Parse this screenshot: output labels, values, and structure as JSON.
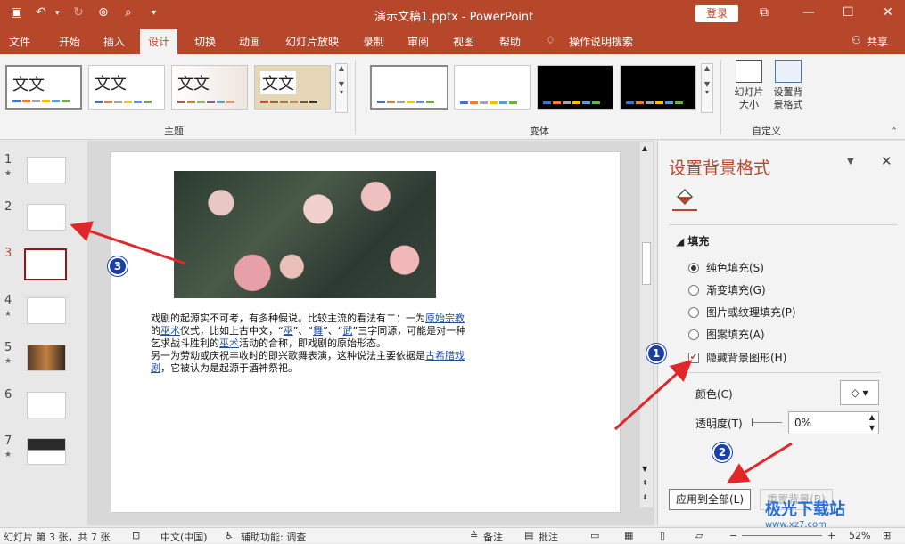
{
  "window": {
    "title": "演示文稿1.pptx  -  PowerPoint",
    "login_label": "登录",
    "share_label": "共享",
    "tell_me": "操作说明搜索"
  },
  "tabs": [
    "文件",
    "开始",
    "插入",
    "设计",
    "切换",
    "动画",
    "幻灯片放映",
    "录制",
    "审阅",
    "视图",
    "帮助"
  ],
  "ribbon": {
    "theme_group_label": "主题",
    "variant_group_label": "变体",
    "custom_group_label": "自定义",
    "theme_samples": [
      "文文",
      "文文",
      "文文",
      "文文"
    ],
    "slide_size_label": "幻灯片\n大小",
    "format_bg_label": "设置背\n景格式"
  },
  "thumbnails": [
    {
      "num": "1",
      "star": "★"
    },
    {
      "num": "2",
      "star": ""
    },
    {
      "num": "3",
      "star": ""
    },
    {
      "num": "4",
      "star": "★"
    },
    {
      "num": "5",
      "star": "★"
    },
    {
      "num": "6",
      "star": ""
    },
    {
      "num": "7",
      "star": "★"
    }
  ],
  "slide": {
    "line1a": "戏剧的起源实不可考，有多种假说。比较主流的看法有二：一为",
    "link1": "原始宗教",
    "line1b": "的",
    "link2": "巫术",
    "line1c": "仪式，比如上古中文，“",
    "link3": "巫",
    "line1d": "”、“",
    "link4": "舞",
    "line1e": "”、“",
    "link5": "武",
    "line1f": "”三字同源，可能是对一种乞求战斗胜利的",
    "link6": "巫术",
    "line1g": "活动的合称，即戏剧的原始形态。",
    "line2a": "另一为劳动或庆祝丰收时的即兴歌舞表演，这种说法主要依据是",
    "link7": "古希腊戏剧",
    "line2b": "，它被认为是起源于酒神祭祀。"
  },
  "pane": {
    "title": "设置背景格式",
    "fill_header": "填充",
    "options": [
      "纯色填充(S)",
      "渐变填充(G)",
      "图片或纹理填充(P)",
      "图案填充(A)"
    ],
    "hide_bg_label": "隐藏背景图形(H)",
    "color_label": "颜色(C)",
    "transparency_label": "透明度(T)",
    "transparency_value": "0%",
    "apply_all_label": "应用到全部(L)",
    "reset_label": "重置背景(B)"
  },
  "status": {
    "slide_info": "幻灯片 第 3 张，共 7 张",
    "language": "中文(中国)",
    "accessibility": "辅助功能: 调查",
    "notes": "备注",
    "comments": "批注",
    "zoom": "52%"
  },
  "markers": [
    "1",
    "2",
    "3"
  ],
  "watermark": {
    "brand": "极光下载站",
    "url": "www.xz7.com"
  },
  "colors": {
    "accent": "#b7472a",
    "marker": "#1a3fa8",
    "arrow": "#e0282a"
  }
}
